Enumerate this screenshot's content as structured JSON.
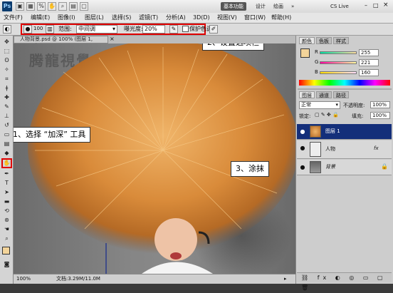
{
  "titlebar": {
    "logo": "Ps",
    "workspace_buttons": [
      "基本功能",
      "设计",
      "绘画",
      "CS Live"
    ],
    "active_workspace": "基本功能"
  },
  "menus": [
    "文件(F)",
    "编辑(E)",
    "图像(I)",
    "图层(L)",
    "选择(S)",
    "滤镜(T)",
    "分析(A)",
    "3D(D)",
    "视图(V)",
    "窗口(W)",
    "帮助(H)"
  ],
  "options": {
    "brush_size": "100",
    "range_label": "范围:",
    "range_value": "中间调",
    "exposure_label": "曝光度:",
    "exposure_value": "20%",
    "protect_label": "保护色调"
  },
  "document": {
    "tab_label": "人物背景.psd @ 100% (图层 1, RGB/8) *",
    "zoom": "100%",
    "doc_info": "文档:3.29M/11.0M",
    "watermark": "腾龍視覺"
  },
  "callouts": {
    "step1": "1、选择 “加深” 工具",
    "step2": "2、设置选项栏",
    "step3": "3、涂抹"
  },
  "color_panel": {
    "tabs": [
      "颜色",
      "色板",
      "样式"
    ],
    "r_label": "R",
    "r_value": "255",
    "g_label": "G",
    "g_value": "221",
    "b_label": "B",
    "b_value": "160"
  },
  "layers_panel": {
    "tabs": [
      "图层",
      "通道",
      "路径"
    ],
    "blend_mode": "正常",
    "opacity_label": "不透明度:",
    "opacity_value": "100%",
    "lock_label": "锁定:",
    "fill_label": "填充:",
    "fill_value": "100%",
    "layers": [
      {
        "name": "图层 1",
        "selected": true
      },
      {
        "name": "人物",
        "selected": false,
        "fx": "fx"
      },
      {
        "name": "背景",
        "selected": false
      }
    ]
  },
  "colors": {
    "highlight_red": "#e00000",
    "selected_layer": "#142f7a",
    "hair_orange": "#d98b3a"
  }
}
